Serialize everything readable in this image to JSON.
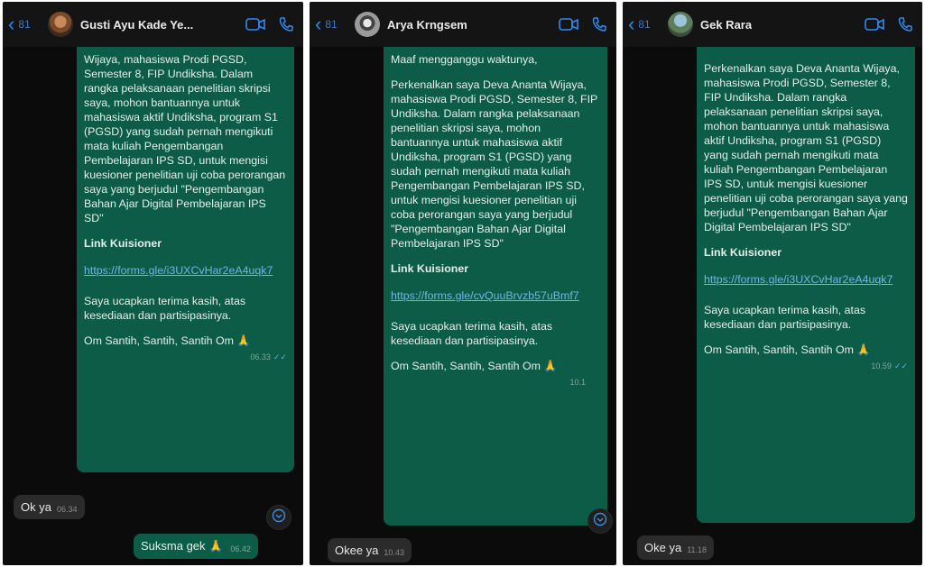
{
  "colors": {
    "accent": "#2b8cf5",
    "bubble_out": "#0d5c47",
    "bubble_in": "#2b2b2b",
    "link": "#6fb4e8"
  },
  "icons": [
    "chevron-left-icon",
    "video-call-icon",
    "phone-icon",
    "scroll-down-icon",
    "praying-hands-emoji"
  ],
  "panels": [
    {
      "back": {
        "count": "81"
      },
      "contact": {
        "name": "Gusti Ayu Kade Ye..."
      },
      "message": {
        "paragraphs": [
          "Wijaya, mahasiswa Prodi PGSD, Semester 8, FIP Undiksha. Dalam rangka pelaksanaan penelitian skripsi saya, mohon bantuannya untuk mahasiswa aktif Undiksha, program S1 (PGSD) yang sudah pernah mengikuti mata kuliah Pengembangan Pembelajaran IPS SD, untuk mengisi kuesioner penelitian uji coba perorangan saya yang berjudul \"Pengembangan Bahan Ajar Digital Pembelajaran IPS SD\""
        ],
        "link_heading": "Link Kuisioner",
        "url": "https://forms.gle/i3UXCvHar2eA4uqk7",
        "thanks": "Saya ucapkan terima kasih, atas kesediaan dan partisipasinya.",
        "closing": "Om Santih, Santih, Santih Om 🙏",
        "time": "06.33"
      },
      "incoming": {
        "text": "Ok ya",
        "time": "06.34"
      },
      "outgoing": {
        "text": "Suksma gek 🙏",
        "time": "06.42"
      }
    },
    {
      "back": {
        "count": "81"
      },
      "contact": {
        "name": "Arya Krngsem"
      },
      "message": {
        "paragraphs": [
          "Maaf mengganggu waktunya,",
          "Perkenalkan saya Deva Ananta Wijaya, mahasiswa Prodi PGSD, Semester 8, FIP Undiksha. Dalam rangka pelaksanaan penelitian skripsi saya, mohon bantuannya untuk mahasiswa aktif Undiksha, program S1 (PGSD) yang sudah pernah mengikuti mata kuliah Pengembangan Pembelajaran IPS SD, untuk mengisi kuesioner penelitian uji coba perorangan saya yang berjudul \"Pengembangan Bahan Ajar Digital Pembelajaran IPS SD\""
        ],
        "link_heading": "Link Kuisioner",
        "url": "https://forms.gle/cvQuuBrvzb57uBmf7",
        "thanks": "Saya ucapkan terima kasih, atas kesediaan dan partisipasinya.",
        "closing": "Om Santih, Santih, Santih Om 🙏",
        "time": "10.1"
      },
      "incoming": {
        "text": "Okee ya",
        "time": "10.43"
      }
    },
    {
      "back": {
        "count": "81"
      },
      "contact": {
        "name": "Gek Rara"
      },
      "message": {
        "paragraphs": [
          "Perkenalkan saya Deva Ananta Wijaya, mahasiswa Prodi PGSD, Semester 8, FIP Undiksha. Dalam rangka pelaksanaan penelitian skripsi saya, mohon bantuannya untuk mahasiswa aktif Undiksha, program S1 (PGSD) yang sudah pernah mengikuti mata kuliah Pengembangan Pembelajaran IPS SD, untuk mengisi kuesioner penelitian uji coba perorangan saya yang berjudul \"Pengembangan Bahan Ajar Digital Pembelajaran IPS SD\""
        ],
        "link_heading": "Link Kuisioner",
        "url": "https://forms.gle/i3UXCvHar2eA4uqk7",
        "thanks": "Saya ucapkan terima kasih, atas kesediaan dan partisipasinya.",
        "closing": "Om Santih, Santih, Santih Om 🙏",
        "time": "10.59"
      },
      "incoming": {
        "text": "Oke ya",
        "time": "11.18"
      }
    }
  ]
}
